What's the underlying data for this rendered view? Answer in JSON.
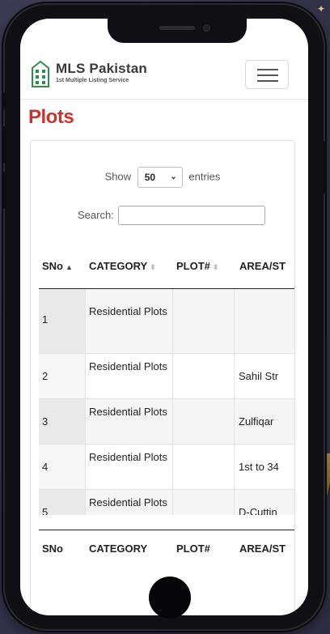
{
  "app": {
    "brand_name": "MLS Pakistan",
    "brand_subtitle": "1st Multiple Listing Service",
    "page_title": "Plots"
  },
  "table_controls": {
    "show_label": "Show",
    "entries_value": "50",
    "entries_label": "entries",
    "search_label": "Search:",
    "search_value": ""
  },
  "table": {
    "headers": [
      "SNo",
      "CATEGORY",
      "PLOT#",
      "AREA/ST"
    ],
    "footer_headers": [
      "SNo",
      "CATEGORY",
      "PLOT#",
      "AREA/ST"
    ],
    "rows": [
      {
        "sno": "1",
        "category": "Residential Plots",
        "plot": "",
        "area": ""
      },
      {
        "sno": "2",
        "category": "Residential Plots",
        "plot": "",
        "area": "Sahil Str"
      },
      {
        "sno": "3",
        "category": "Residential Plots",
        "plot": "",
        "area": "Zulfiqar"
      },
      {
        "sno": "4",
        "category": "Residential Plots",
        "plot": "",
        "area": "1st to 34"
      },
      {
        "sno": "5",
        "category": "Residential Plots",
        "plot": "",
        "area": "D-Cuttin"
      }
    ]
  },
  "colors": {
    "title_red": "#c8342e",
    "logo_green": "#2e8b4e"
  },
  "icons": {
    "logo": "building-icon",
    "menu": "hamburger-menu-icon",
    "sort_asc": "sort-asc-icon",
    "sort_both": "sort-both-icon",
    "select": "chevron-down-icon"
  }
}
